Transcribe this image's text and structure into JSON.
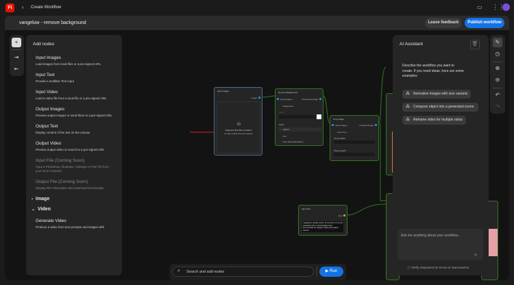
{
  "app": {
    "logo": "Fi",
    "back_icon": "chevron-left-icon",
    "title": "Create Workflow"
  },
  "header": {
    "workflow_name": "vangeluw - remove background",
    "leave_feedback": "Leave feedback",
    "publish": "Publish workflow"
  },
  "add_nodes": {
    "title": "Add nodes",
    "items": [
      {
        "title": "Input Images",
        "desc": "Load images from local files or a pre-signed URL"
      },
      {
        "title": "Input Text",
        "desc": "Provide a multiline Text input"
      },
      {
        "title": "Input Video",
        "desc": "Load a video file from a local file or a pre-signed URL"
      },
      {
        "title": "Output Images",
        "desc": "Preview output images or send them to a pre-signed URL"
      },
      {
        "title": "Output Text",
        "desc": "Display content of the text on the canvas"
      },
      {
        "title": "Output Video",
        "desc": "Preview output video or send it to a pre-signed URL"
      },
      {
        "title": "Input File (Coming Soon)",
        "desc": "Input a Photoshop, Illustrator, Indesign or PDF file from your local computer"
      },
      {
        "title": "Output File (Coming Soon)",
        "desc": "Display File Information with download functionality"
      }
    ],
    "sections": [
      {
        "label": "Image",
        "expanded": false
      },
      {
        "label": "Video",
        "expanded": true
      }
    ],
    "video_items": [
      {
        "title": "Generate Video",
        "desc": "Produce a video from text prompts and images with"
      }
    ]
  },
  "nodes": {
    "input_images": {
      "title": "Input Images",
      "port": "Image",
      "drop": "Drag and drop files or folders",
      "drop_sub": "Or select a folder from your computer"
    },
    "remove_bg": {
      "title": "Remove Background",
      "in": "Input Image 1",
      "out": "Processed Image",
      "transparent": "Transparent",
      "color": "Color",
      "mode": "Mode",
      "mode_value": "Hybrid",
      "trim": "Trim",
      "decontam": "Color Decontamination"
    },
    "crop": {
      "title": "Crop Image",
      "in": "Input Image 1",
      "out": "Cropped Image",
      "auto": "Auto Crop",
      "width": "Target Width",
      "height": "Target Height"
    },
    "input_text": {
      "title": "Input Text",
      "port": "Text",
      "value": "magazine quality photo of a phone on a red pedestal with a pink background surrounded by origami style pink paper hearts"
    }
  },
  "search": {
    "placeholder": "Search and add nodes",
    "run": "Run"
  },
  "ai": {
    "title": "AI Assistant",
    "intro": "Describe the workflow you want to create. If you need ideas, here are some examples:",
    "suggestions": [
      "Normalize images with size variants",
      "Compose object into a generated scene",
      "Reframe video for multiple ratios"
    ],
    "input_placeholder": "Ask me anything about your workflow...",
    "disclaimer": "Verify responses for errors or inaccuracies."
  },
  "colors": {
    "accent": "#1473e6",
    "brand": "#eb1000",
    "edge": "#2e7a1e",
    "port": "#2a8be0"
  }
}
